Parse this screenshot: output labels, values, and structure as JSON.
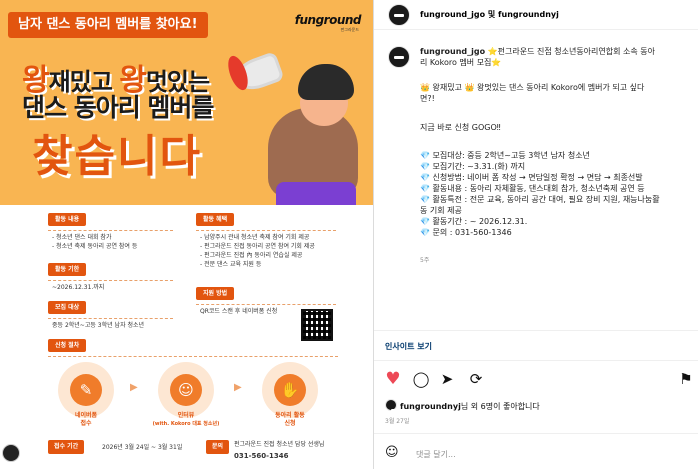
{
  "poster": {
    "banner": "남자 댄스 동아리 멤버를 찾아요!",
    "brand": "funground",
    "brand_sub": "펀그라운드",
    "headline_1_pre": "왕",
    "headline_1_mid": "재밌고 ",
    "headline_1_big2": "왕",
    "headline_1_post": "멋있는",
    "headline_2": "댄스 동아리 멤버를",
    "headline_3": "찾습니다",
    "sections": {
      "activity": {
        "tag": "활동 내용",
        "lines": [
          "- 청소년 댄스 대회 참가",
          "- 청소년 축제 동아리 공연 참여 등"
        ]
      },
      "benefit": {
        "tag": "활동 혜택",
        "lines": [
          "- 남양주시 관내 청소년 축제 참여 기회 제공",
          "- 펀그라운드 진접 동아리 공연 참여 기회 제공",
          "- 펀그라운드 진접 內 동아리 연습실 제공",
          "- 전문 댄스 교육 지원 등"
        ]
      },
      "period": {
        "tag": "활동 기한",
        "lines": [
          "~2026.12.31.까지"
        ]
      },
      "apply": {
        "tag": "지원 방법",
        "lines": [
          "QR코드 스캔 후 네이버폼 신청"
        ]
      },
      "target": {
        "tag": "모집 대상",
        "lines": [
          "중등 2학년~고등 3학년 남자 청소년"
        ]
      },
      "process": {
        "tag": "신청 절차"
      }
    },
    "steps": [
      {
        "icon": "form-icon",
        "glyph": "✎",
        "label_1": "네이버폼",
        "label_2": "접수"
      },
      {
        "icon": "interview-icon",
        "glyph": "☺",
        "label_1": "인터뷰",
        "label_2": "(with. Kokoro 대표 청소년)"
      },
      {
        "icon": "handshake-icon",
        "glyph": "✋",
        "label_1": "동아리 활동",
        "label_2": "신청"
      }
    ],
    "footer": {
      "period_tag": "접수 기간",
      "period_value": "2026년 3월 24일 ~ 3월 31일",
      "contact_tag": "문의",
      "contact_value_1": "펀그라운드 진접 청소년 담당 선생님",
      "contact_value_2": "031-560-1346"
    }
  },
  "post": {
    "header_name": "funground_jgo 및 fungroundnyj",
    "caption": {
      "author": "funground_jgo",
      "line1_rest": " ⭐펀그라운드 진접 청소년동아리연합회 소속 동아",
      "line2": "리 Kokoro 멤버 모집⭐",
      "line3": "👑 왕재밌고 👑 왕멋있는 댄스 동아리 Kokoro에 멤버가 되고 싶다",
      "line4": "면?!",
      "line5": "지금 바로 신청 GOGO‼",
      "items": [
        "💎 모집대상: 중등 2학년~고등 3학년 남자 청소년",
        "💎 모집기간: ~3.31.(화) 까지",
        "💎 신청방법: 네이버 폼 작성 → 면담일정 확정 → 면담 → 최종선발",
        "💎 활동내용 : 동아리 자체활동, 댄스대회 참가, 청소년축제 공연 등",
        "💎 활동특전 : 전문 교육, 동아리 공간 대여, 필요 장비 지원, 재능나눔활",
        "동 기회 제공",
        "💎 활동기간 : ~ 2026.12.31.",
        "💎 문의 : 031-560-1346"
      ],
      "time": "5주"
    },
    "insights": "인사이트 보기",
    "likes_user": "fungroundnyj",
    "likes_rest": "님 외 6명이 좋아합니다",
    "date": "3월 27일",
    "comment_placeholder": "댓글 달기..."
  },
  "colors": {
    "accent": "#e2550f",
    "poster_bg": "#f9b552",
    "heart": "#ed4956",
    "link": "#00376b"
  }
}
